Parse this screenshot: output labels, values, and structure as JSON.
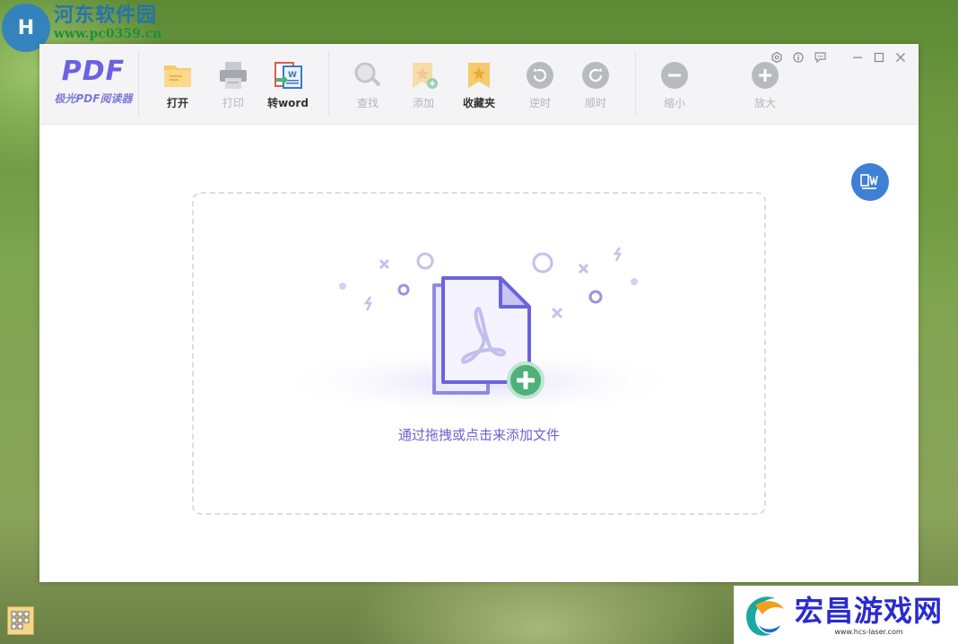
{
  "watermark_top": {
    "title": "河东软件园",
    "url": "www.pc0359.cn",
    "logo_letter": "H"
  },
  "brand": {
    "mark": "PDF",
    "name": "极光PDF阅读器"
  },
  "toolbar": {
    "open": "打开",
    "print": "打印",
    "to_word": "转word",
    "find": "查找",
    "add": "添加",
    "favorites": "收藏夹",
    "rotate_ccw": "逆时",
    "rotate_cw": "顺时",
    "zoom_out": "缩小",
    "zoom_in": "放大"
  },
  "window_controls": [
    "settings-icon",
    "info-icon",
    "feedback-icon",
    "minimize-icon",
    "maximize-icon",
    "close-icon"
  ],
  "dropzone": {
    "text": "通过拖拽或点击来添加文件"
  },
  "watermark_bottom": {
    "title": "宏昌游戏网",
    "url": "www.hcs-laser.com"
  },
  "colors": {
    "accent": "#6b62e0",
    "folder": "#f6c96a",
    "add_badge": "#4fb07a",
    "float_button": "#3f7fd6"
  }
}
